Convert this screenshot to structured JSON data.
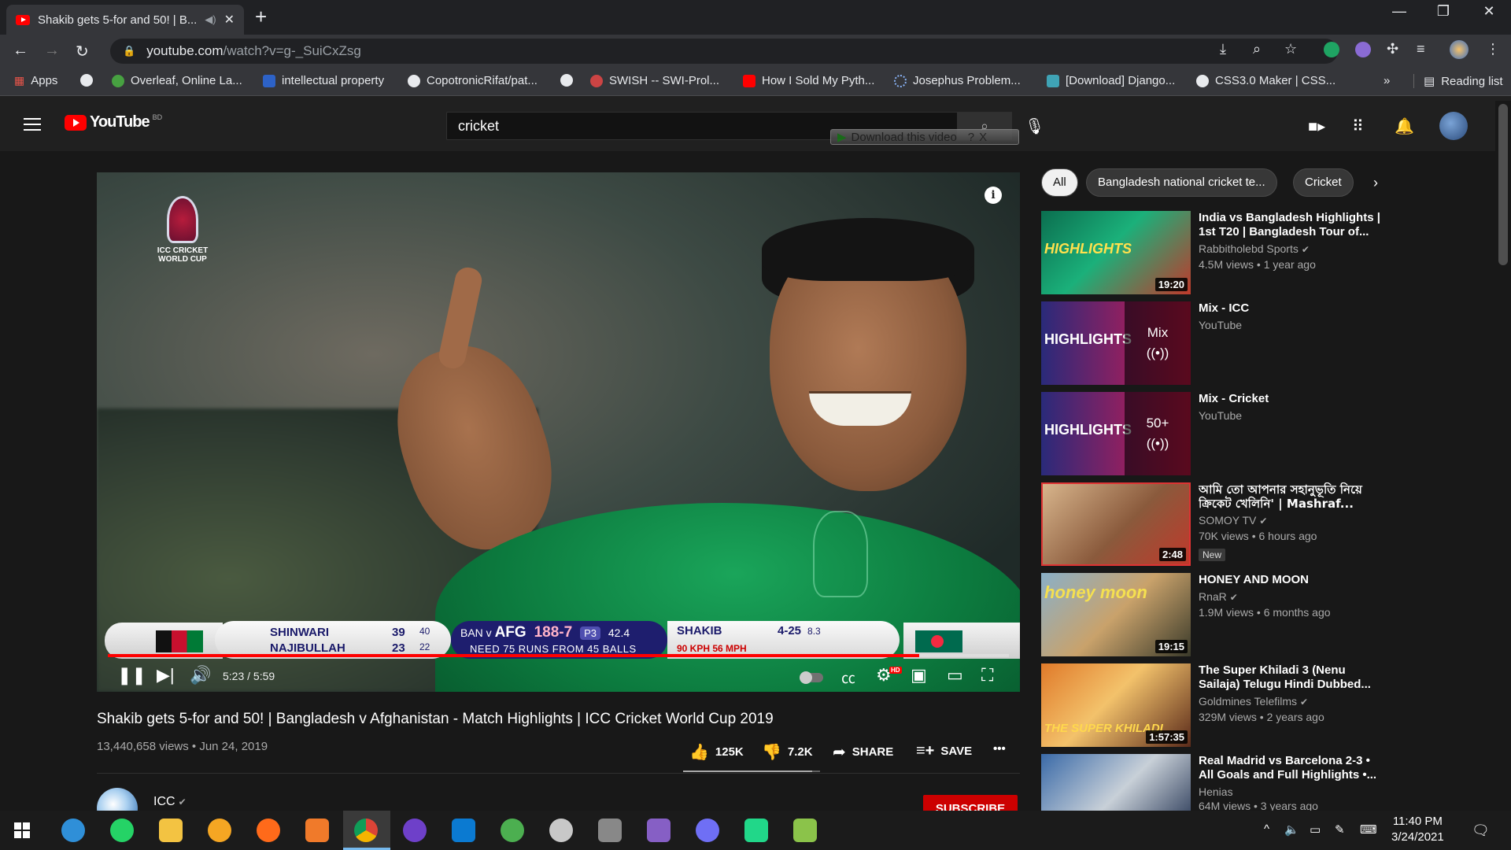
{
  "browser": {
    "tab_title": "Shakib gets 5-for and 50! | B...",
    "url_host": "youtube.com",
    "url_path": "/watch?v=g-_SuiCxZsg",
    "bookmarks": [
      "Apps",
      "Overleaf, Online La...",
      "intellectual property",
      "CopotronicRifat/pat...",
      "SWISH -- SWI-Prol...",
      "How I Sold My Pyth...",
      "Josephus Problem...",
      "[Download] Django...",
      "CSS3.0 Maker | CSS...",
      "Reading list"
    ],
    "more_bookmarks": "»"
  },
  "youtube": {
    "logo_text": "YouTube",
    "country": "BD",
    "search_value": "cricket",
    "download_overlay": "Download this video",
    "download_overlay_badge": "?",
    "download_overlay_close": "X"
  },
  "player": {
    "current_time": "5:23",
    "duration": "5:59",
    "time_display": "5:23 / 5:59",
    "progress_fraction": 0.9,
    "icc_logo_text": "ICC CRICKET WORLD CUP",
    "scoreboard": {
      "batter1": "SHINWARI",
      "batter1_runs": "39",
      "batter1_balls": "40",
      "batter2": "NAJIBULLAH",
      "batter2_runs": "23",
      "batter2_balls": "22",
      "match_prefix": "BAN v",
      "batting_team": "AFG",
      "score": "188-7",
      "powerplay": "P3",
      "overs": "42.4",
      "need": "NEED 75 RUNS FROM 45 BALLS",
      "bowler": "SHAKIB",
      "bowler_figures": "4-25",
      "bowler_overs": "8.3",
      "speed": "90 KPH  56 MPH"
    }
  },
  "video": {
    "title": "Shakib gets 5-for and 50! | Bangladesh v Afghanistan - Match Highlights | ICC Cricket World Cup 2019",
    "views": "13,440,658 views",
    "date": "Jun 24, 2019",
    "meta": "13,440,658 views • Jun 24, 2019",
    "likes": "125K",
    "dislikes": "7.2K",
    "like_fraction": 0.945,
    "share_label": "SHARE",
    "save_label": "SAVE",
    "more_label": "•••",
    "channel": "ICC",
    "subscribe_label": "SUBSCRIBE"
  },
  "chips": [
    "All",
    "Bangladesh national cricket te...",
    "Cricket"
  ],
  "recommendations": [
    {
      "title": "India vs Bangladesh Highlights | 1st T20 | Bangladesh Tour of...",
      "channel": "Rabbitholebd Sports",
      "verified": true,
      "stats": "4.5M views • 1 year ago",
      "duration": "19:20",
      "thumb_text": "HIGHLIGHTS"
    },
    {
      "title": "Mix - ICC",
      "channel": "YouTube",
      "verified": false,
      "stats": "",
      "mix_label": "Mix",
      "thumb_text": "HIGHLIGHTS"
    },
    {
      "title": "Mix - Cricket",
      "channel": "YouTube",
      "verified": false,
      "stats": "",
      "mix_label": "50+",
      "thumb_text": "HIGHLIGHTS"
    },
    {
      "title": "আমি তো আপনার সহানুভূতি নিয়ে ক্রিকেট খেলিনি' | Mashraf...",
      "channel": "SOMOY TV",
      "verified": true,
      "stats": "70K views • 6 hours ago",
      "duration": "2:48",
      "badge": "New"
    },
    {
      "title": "HONEY AND MOON",
      "channel": "RnaR",
      "verified": true,
      "stats": "1.9M views • 6 months ago",
      "duration": "19:15",
      "thumb_text": "honey moon"
    },
    {
      "title": "The Super Khiladi 3 (Nenu Sailaja) Telugu Hindi Dubbed...",
      "channel": "Goldmines Telefilms",
      "verified": true,
      "stats": "329M views • 2 years ago",
      "duration": "1:57:35",
      "thumb_text": "THE SUPER KHILADI"
    },
    {
      "title": "Real Madrid vs Barcelona 2-3 • All Goals and Full Highlights •...",
      "channel": "Henias",
      "verified": false,
      "stats": "64M views • 3 years ago"
    }
  ],
  "taskbar": {
    "time": "11:40 PM",
    "date": "3/24/2021"
  },
  "colors": {
    "yt_red": "#ff0000",
    "bg": "#181818",
    "subscribe": "#cc0000"
  }
}
